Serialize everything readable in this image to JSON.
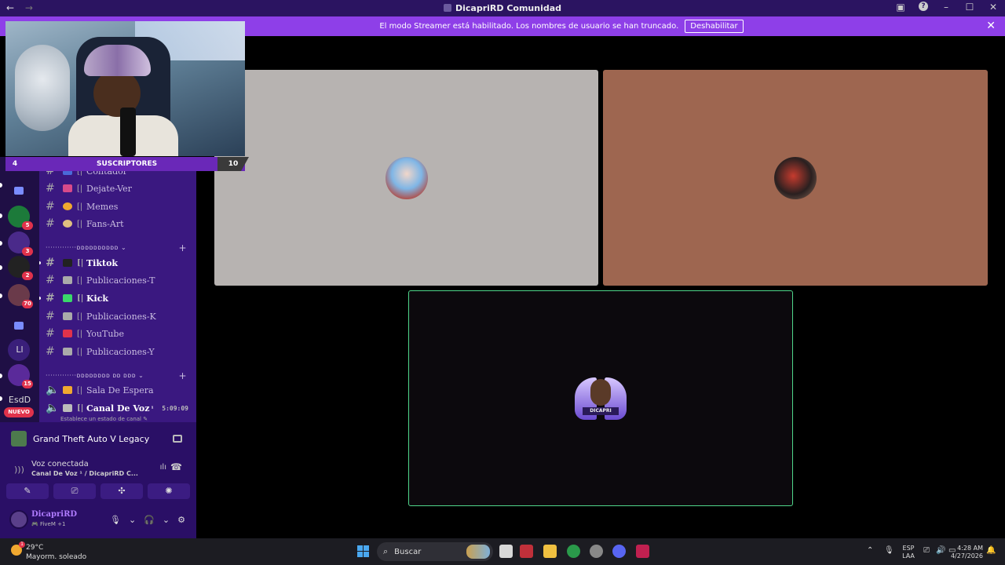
{
  "titlebar": {
    "back": "←",
    "forward": "→",
    "title": "DicapriRD Comunidad",
    "inbox_icon": "inbox-icon",
    "help": "?",
    "minimize": "–",
    "maximize": "☐",
    "close": "✕"
  },
  "banner": {
    "text": "El modo Streamer está habilitado. Los nombres de usuario se han truncado.",
    "button": "Deshabilitar",
    "close": "✕",
    "color": "#8e3fe8"
  },
  "overlay": {
    "left_count": "4",
    "label": "SUSCRIPTORES",
    "right_count": "10"
  },
  "rail": {
    "badges": [
      "5",
      "3",
      "2",
      "70",
      "15"
    ],
    "text_li": "Ll",
    "text_esdd": "EsdD",
    "new_label": "NUEVO"
  },
  "channels": {
    "partial": "Contador",
    "items1": [
      {
        "name": "Dejate-Ver"
      },
      {
        "name": "Memes"
      },
      {
        "name": "Fans-Art"
      }
    ],
    "category1": "·············ᴅᴅᴅᴅᴅᴅᴅᴅᴅᴅ ⌄",
    "items2": [
      {
        "name": "Tiktok"
      },
      {
        "name": "Publicaciones-T"
      },
      {
        "name": "Kick"
      },
      {
        "name": "Publicaciones-K"
      },
      {
        "name": "YouTube"
      },
      {
        "name": "Publicaciones-Y"
      }
    ],
    "category2": "·············ᴅᴅᴅᴅᴅᴅᴅᴅ ᴅᴅ ᴅᴅᴅ ⌄",
    "voice1": "Sala De Espera",
    "voice2": "Canal De Voz",
    "voice2_sup": "¹",
    "voice_time": "5:09:09",
    "status_prompt": "Establece un estado de canal ✎",
    "plus": "+",
    "hash": "#",
    "bar": "[|"
  },
  "panel": {
    "game": "Grand Theft Auto V Legacy",
    "voice_status": "Voz conectada",
    "voice_channel": "Canal De Voz ¹ / DicapriRD C...",
    "signal_icon": "signal-icon",
    "wave": "ılı",
    "hangup": "☎",
    "actions": [
      "✎",
      "⎚",
      "✣",
      "✺"
    ],
    "username": "DicapriRD",
    "activity": "🎮 FiveM +1",
    "controls": [
      "🎙",
      "⌄",
      "🎧",
      "⌄",
      "⚙"
    ]
  },
  "taskbar": {
    "temp": "29°C",
    "weather": "Mayorm. soleado",
    "weather_badge": "1",
    "search": "Buscar",
    "search_icon": "⌕",
    "tray_up": "⌃",
    "lang1": "ESP",
    "lang2": "LAA",
    "time": "4:28 AM",
    "date": "4/27/2026",
    "mic": "🎙",
    "net": "⎚",
    "vol": "🔊",
    "battery": "▭",
    "bell": "🔔"
  }
}
